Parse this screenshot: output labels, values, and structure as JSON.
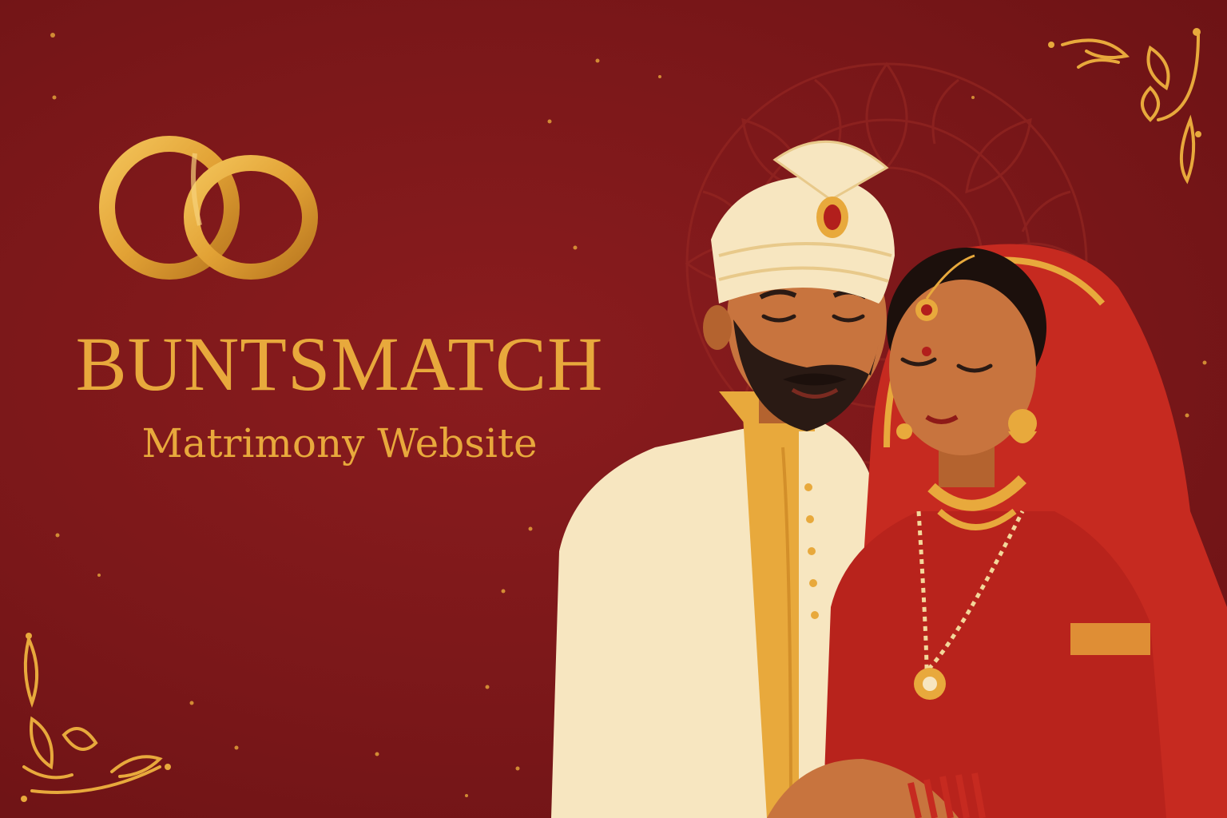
{
  "brand": {
    "title": "BUNTSMATCH",
    "subtitle": "Matrimony Website"
  },
  "colors": {
    "background": "#7a1719",
    "gold": "#e8a93c",
    "cream": "#f7e6c0",
    "red": "#c62a20",
    "skin": "#c8743e"
  },
  "icons": [
    "wedding-rings-icon",
    "mandala-ornament",
    "paisley-corner-ornament"
  ]
}
